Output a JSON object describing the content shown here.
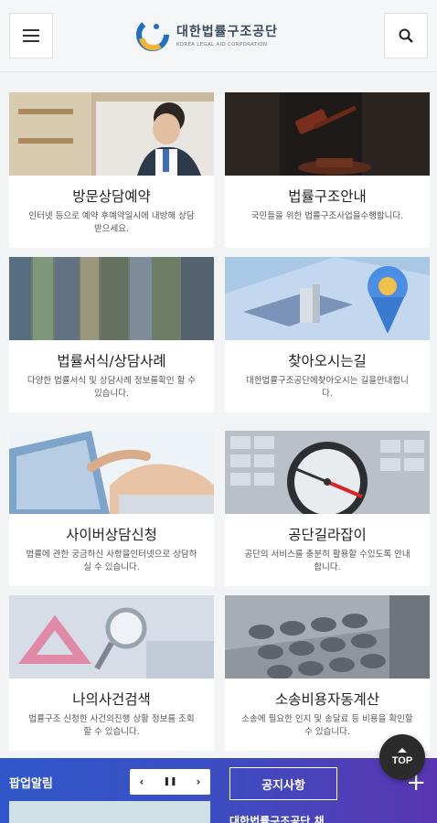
{
  "header": {
    "logo_ko": "대한법률구조공단",
    "logo_en": "KOREA LEGAL AID CORPORATION",
    "menu_icon": "hamburger-icon",
    "search_icon": "search-icon"
  },
  "cards": [
    {
      "title": "방문상담예약",
      "desc": "인터넷 등으로 예약 후예약일시에 내방해 상담 받으세요."
    },
    {
      "title": "법률구조안내",
      "desc": "국민들을 위한 법률구조사업을수행합니다."
    },
    {
      "title": "법률서식/상담사례",
      "desc": "다양한 법률서식 및 상담사례 정보를확인 할 수 있습니다."
    },
    {
      "title": "찾아오시는길",
      "desc": "대한법률구조공단에찾아오시는 길을안내합니다."
    },
    {
      "title": "사이버상담신청",
      "desc": "법률에 관한 궁금하신 사항을인터넷으로 상담하실 수 있습니다."
    },
    {
      "title": "공단길라잡이",
      "desc": "공단의 서비스를 충분히 활용할 수있도록 안내합니다."
    },
    {
      "title": "나의사건검색",
      "desc": "법률구조 신청한 사건의진행 상황 정보를 조회할 수 있습니다."
    },
    {
      "title": "소송비용자동계산",
      "desc": "소송에 필요한 인지 및 송달료 등 비용을 확인할 수 있습니다."
    }
  ],
  "bottom": {
    "popup_title": "팝업알림",
    "pager_prev": "‹",
    "pager_pause": "❚❚",
    "pager_next": "›",
    "notice_label": "공지사항",
    "plus": "+",
    "notice_item": "대한법률구조공단 채"
  },
  "top_button": {
    "label": "TOP"
  },
  "colors": {
    "accent_blue": "#2f57c9",
    "accent_purple": "#5a35b2",
    "top_btn": "#2b2b2b"
  }
}
